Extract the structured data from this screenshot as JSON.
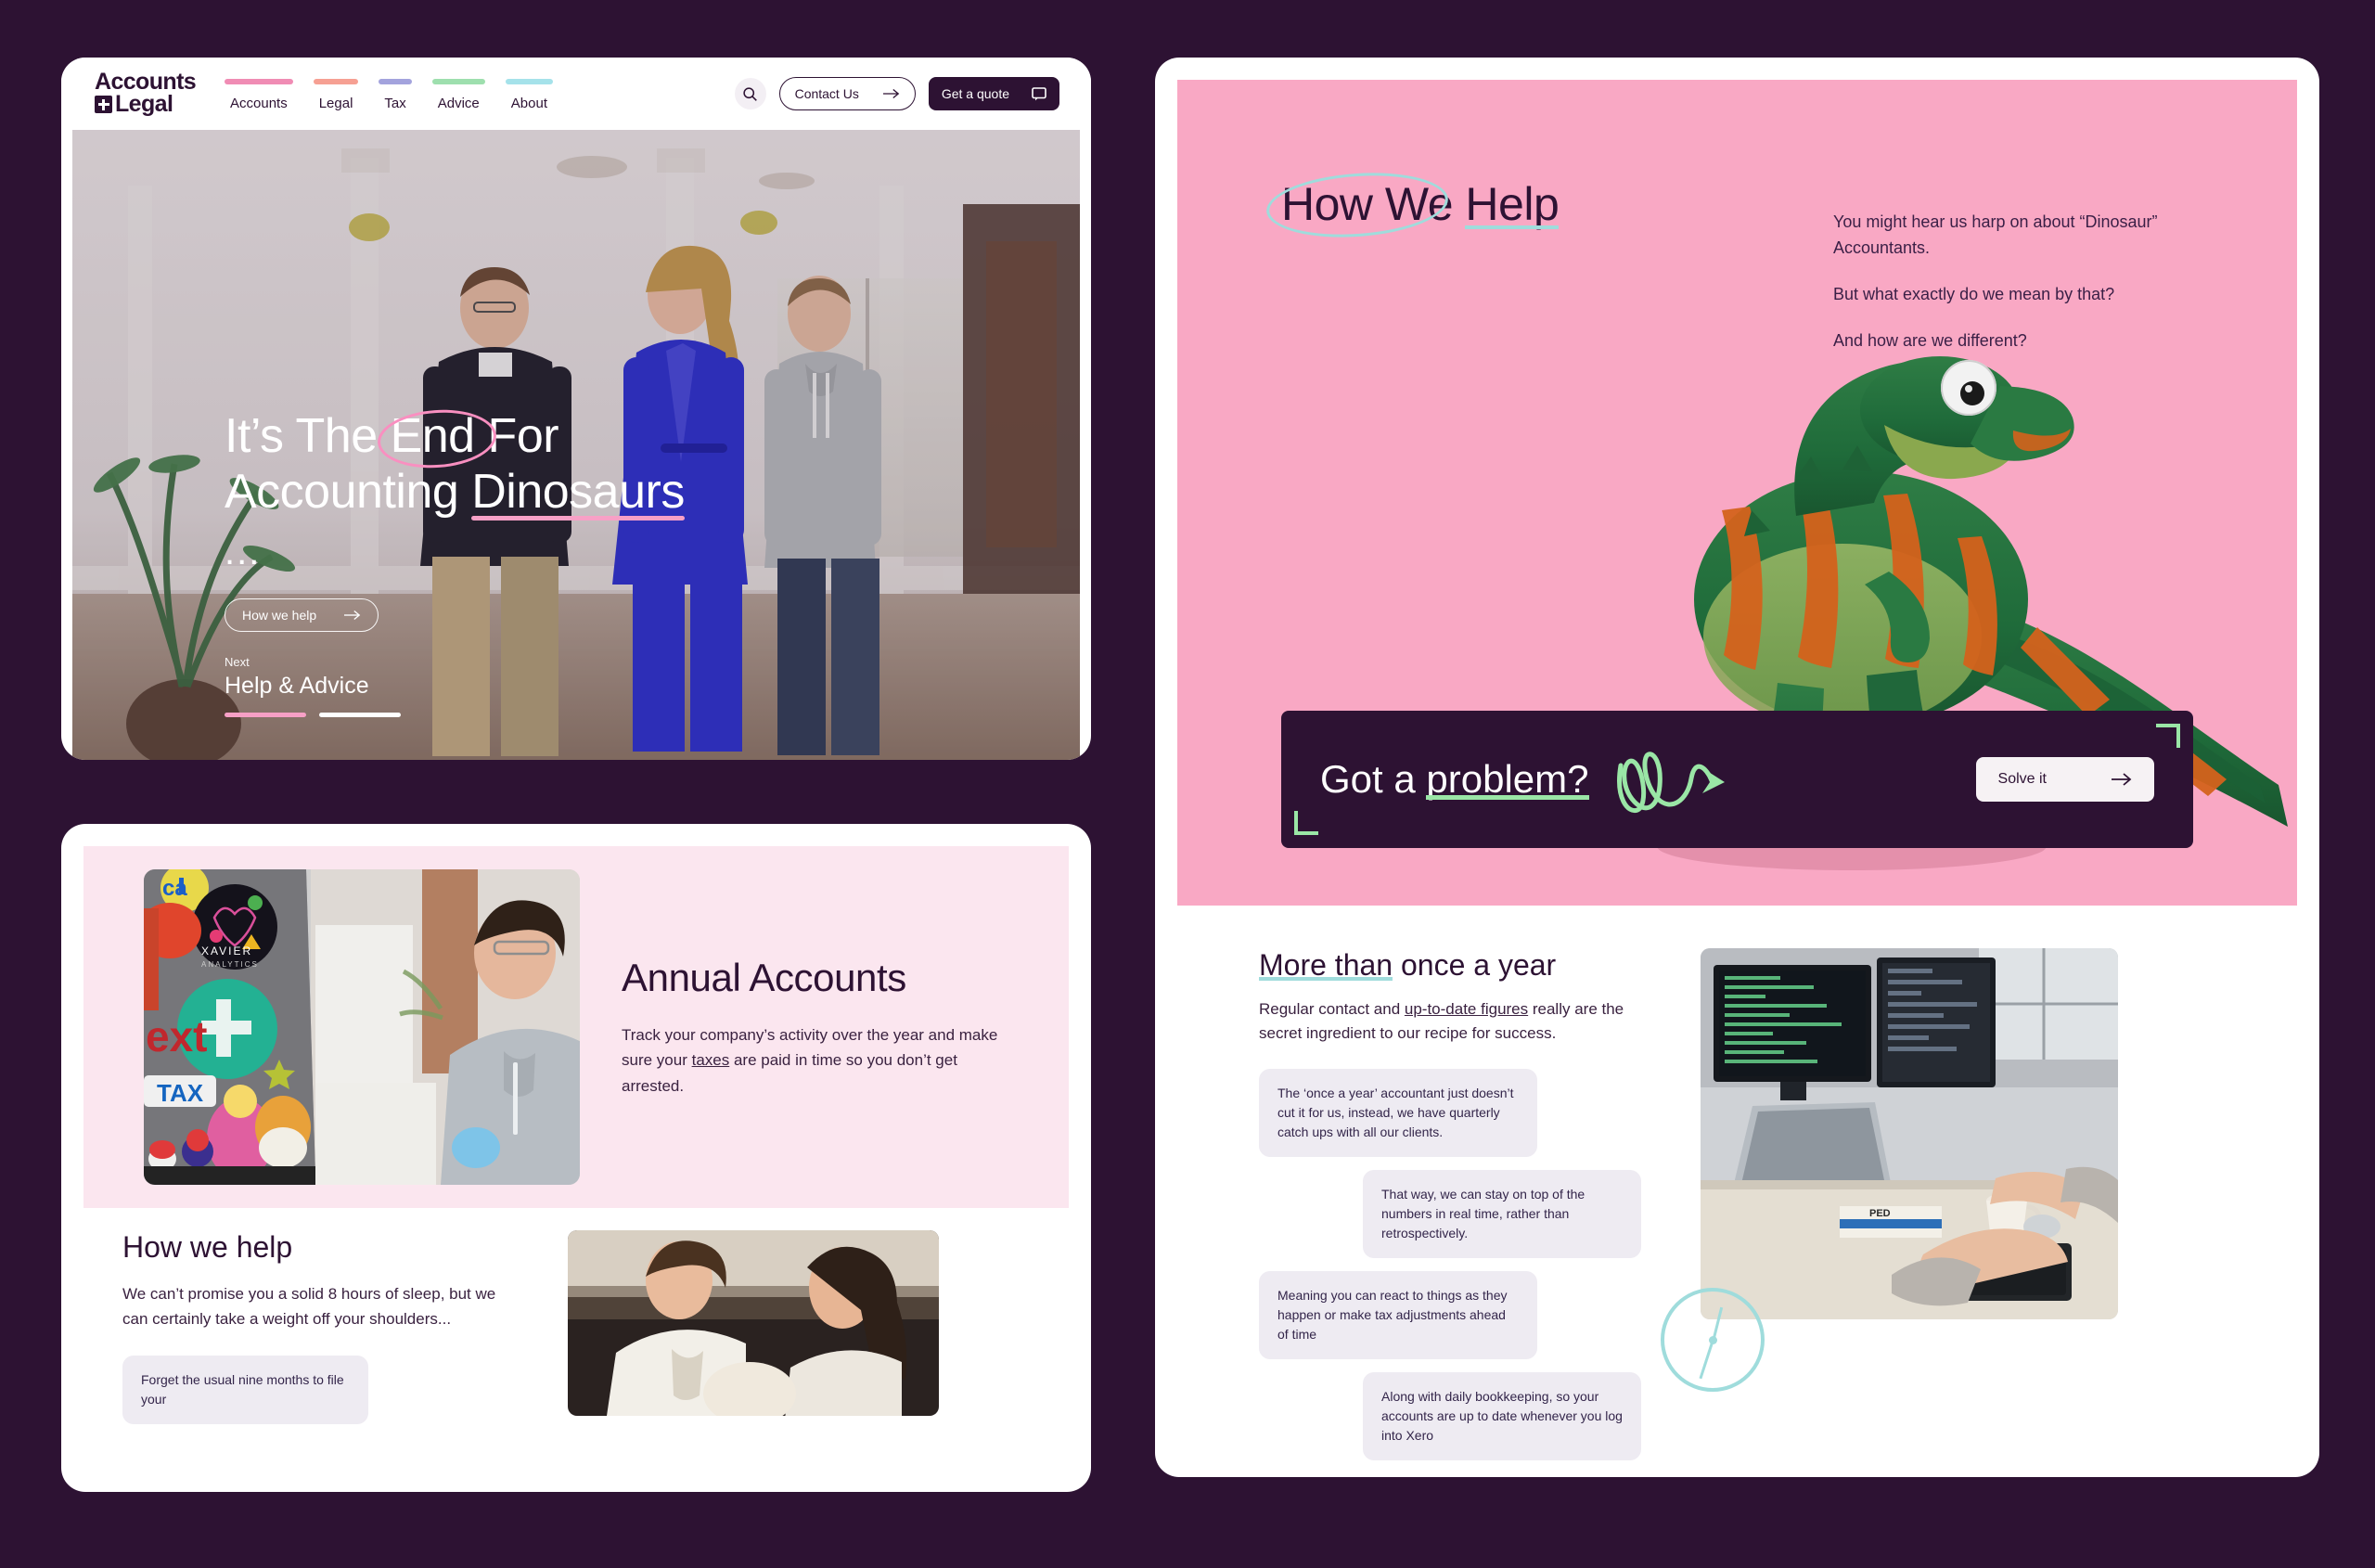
{
  "page": {
    "background_color": "#2d1233",
    "brand_color": "#2d1233",
    "pink": "#f9a8c4",
    "teal": "#9fdcdc",
    "green": "#9ae6a6"
  },
  "header": {
    "logo_line1": "Accounts",
    "logo_line2": "Legal",
    "nav": [
      {
        "label": "Accounts",
        "bar_color": "#f08cb4"
      },
      {
        "label": "Legal",
        "bar_color": "#f6a093"
      },
      {
        "label": "Tax",
        "bar_color": "#a3a3dd"
      },
      {
        "label": "Advice",
        "bar_color": "#9edfae"
      },
      {
        "label": "About",
        "bar_color": "#a5e2ea"
      }
    ],
    "search_icon": "search-icon",
    "contact_button": "Contact Us",
    "quote_button": "Get a quote"
  },
  "hero": {
    "title_part1": "It’s The ",
    "title_circled": "End",
    "title_part2": " For",
    "title_line2_part1": "Accounting ",
    "title_line2_underlined": "Dinosaurs",
    "ellipsis": "...",
    "cta_label": "How we help",
    "next_label": "Next",
    "next_title": "Help & Advice",
    "slides_total": 2,
    "slide_active": 1
  },
  "services": {
    "heading": "Annual Accounts",
    "body_before": "Track your company’s activity over the year and make sure your ",
    "body_link": "taxes",
    "body_after": " are paid in time so you don’t get arrested.",
    "image_alt": "laptop-stickers-photo",
    "sticker_labels": [
      "ca",
      "XAVIER",
      "ANALYTICS",
      "ext",
      "TAX"
    ]
  },
  "how_we_help": {
    "heading": "How we help",
    "body": "We can’t promise you a solid 8 hours of sleep, but we can certainly take a weight off your shoulders...",
    "bubble": "Forget the usual nine months to file your",
    "image_alt": "two-people-meeting-photo"
  },
  "right": {
    "heading_circled": "How",
    "heading_rest": " We ",
    "heading_underlined": "Help",
    "paragraphs": [
      "You might hear us harp on about “Dinosaur” Accountants.",
      "But what exactly do we mean by that?",
      "And how are we different?"
    ],
    "dino_alt": "toy-dinosaur-photo",
    "banner": {
      "text_before": "Got a ",
      "text_underlined": "problem?",
      "squiggle_icon": "squiggly-arrow-icon",
      "button_label": "Solve it"
    },
    "section": {
      "heading_underlined": "More than",
      "heading_rest": " once a year",
      "body_before": "Regular contact and ",
      "body_link": "up-to-date figures",
      "body_after": " really are the secret ingredient to our recipe for success.",
      "messages": [
        {
          "side": "left",
          "text": "The ‘once a year’ accountant just doesn’t cut it for us, instead, we have quarterly catch ups with all our clients."
        },
        {
          "side": "right",
          "text": "That way, we can stay on top of the numbers in real time, rather than retrospectively."
        },
        {
          "side": "left",
          "text": "Meaning you can react to things as they happen or make tax adjustments ahead of time",
          "link": "tax"
        },
        {
          "side": "right",
          "text": "Along with daily bookkeeping, so your accounts are up to date whenever you log into Xero",
          "link": "daily bookkeeping",
          "link2": "Xero"
        }
      ],
      "image_alt": "desk-with-monitors-photo",
      "clock_icon": "clock-icon"
    }
  }
}
